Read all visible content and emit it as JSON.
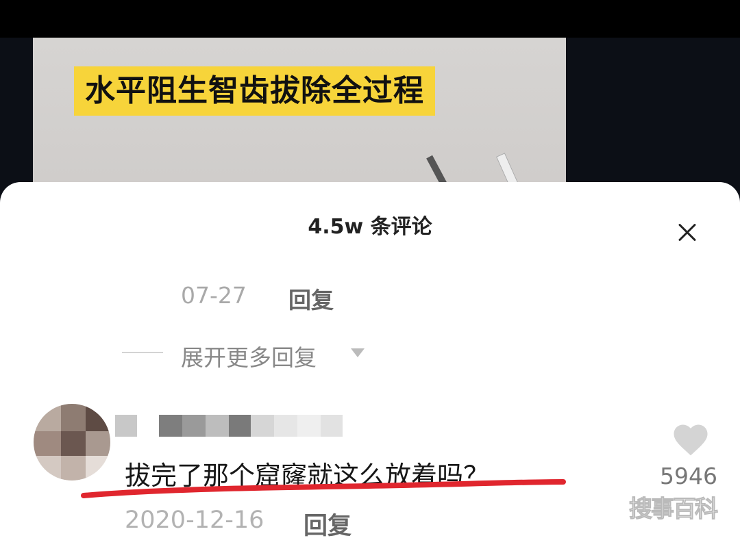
{
  "video": {
    "title": "水平阻生智齿拔除全过程"
  },
  "comments_sheet": {
    "title": "4.5w 条评论",
    "close_icon": "close-icon",
    "previous_reply": {
      "date": "07-27",
      "reply_label": "回复"
    },
    "expand_label": "展开更多回复",
    "comment": {
      "text": "拔完了那个窟窿就这么放着吗？",
      "date": "2020-12-16",
      "reply_label": "回复",
      "likes": "5946",
      "like_icon": "heart-icon"
    }
  },
  "watermark": "搜事百科",
  "colors": {
    "highlight_underline": "#e0262e",
    "title_banner": "#f7d43a"
  }
}
